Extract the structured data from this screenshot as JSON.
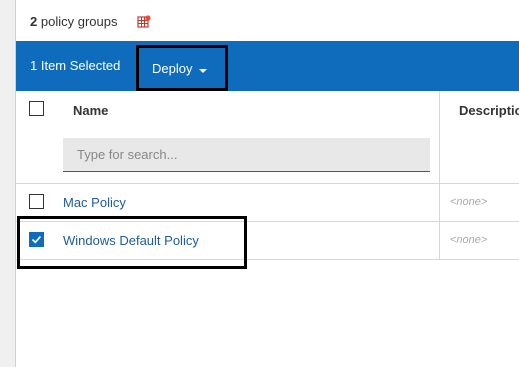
{
  "topbar": {
    "count_number": "2",
    "count_label": "policy groups",
    "icon": "grid-settings-icon"
  },
  "actionbar": {
    "selected_text": "1 Item Selected",
    "deploy_label": "Deploy",
    "color": "#0f6cbd"
  },
  "table": {
    "columns": {
      "name": "Name",
      "description": "Description"
    },
    "search_placeholder": "Type for search...",
    "rows": [
      {
        "name": "Mac Policy",
        "description": "<none>",
        "checked": false
      },
      {
        "name": "Windows Default Policy",
        "description": "<none>",
        "checked": true
      }
    ]
  }
}
